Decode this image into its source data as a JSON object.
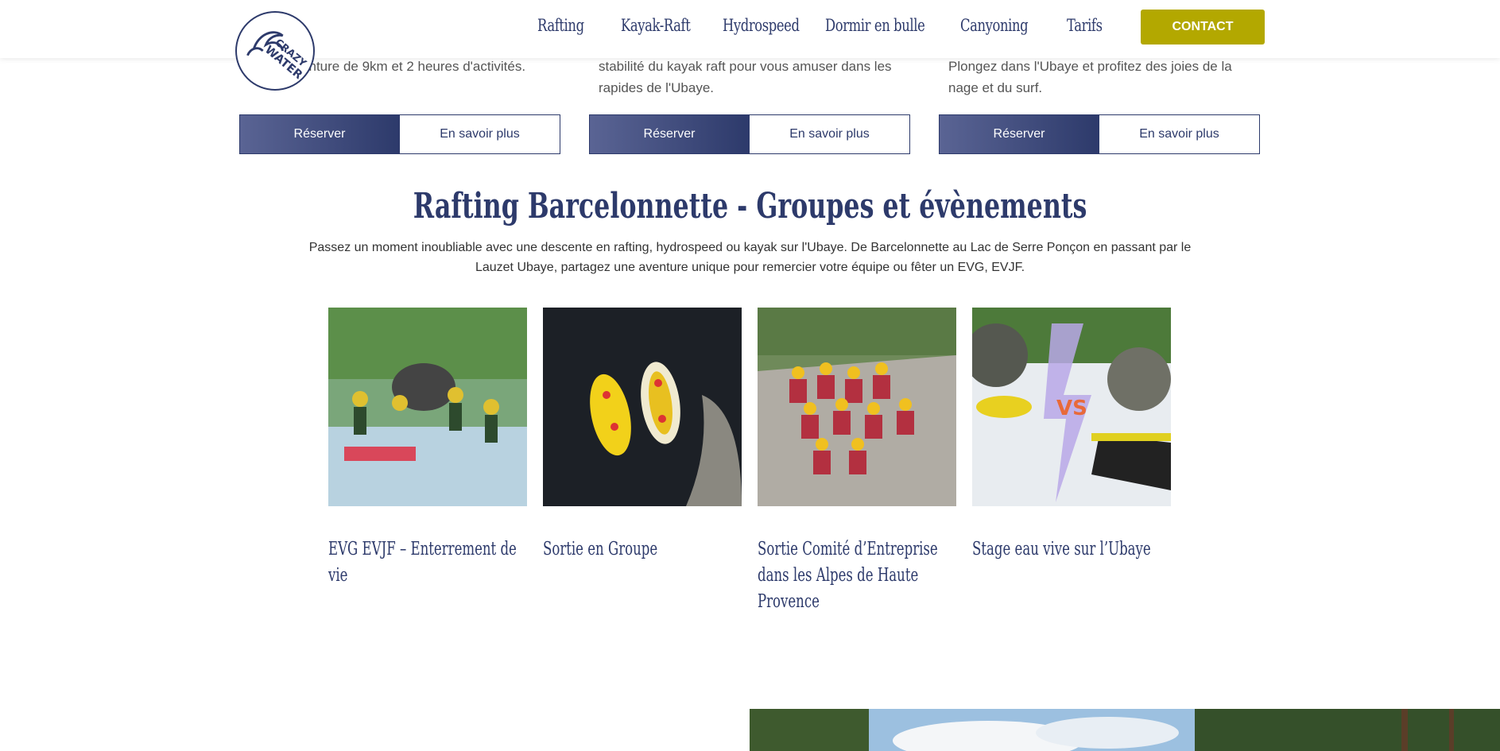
{
  "header": {
    "logo_alt": "Crazy Water",
    "nav": [
      {
        "label": "Rafting"
      },
      {
        "label": "Kayak-Raft"
      },
      {
        "label": "Hydrospeed"
      },
      {
        "label": "Dormir en bulle"
      },
      {
        "label": "Canyoning"
      },
      {
        "label": "Tarifs"
      }
    ],
    "contact_label": "CONTACT"
  },
  "cards": [
    {
      "text": "une aventure de 9km et 2 heures d'activités.",
      "reserve_label": "Réserver",
      "more_label": "En savoir plus"
    },
    {
      "text": "stabilité du kayak raft pour vous amuser dans les rapides de l'Ubaye.",
      "reserve_label": "Réserver",
      "more_label": "En savoir plus"
    },
    {
      "text": "Plongez dans l'Ubaye et profitez des joies de la nage et du surf.",
      "reserve_label": "Réserver",
      "more_label": "En savoir plus"
    }
  ],
  "section": {
    "title": "Rafting Barcelonnette - Groupes et évènements",
    "description": "Passez un moment inoubliable avec une descente en rafting, hydrospeed ou kayak sur l'Ubaye. De Barcelonnette au Lac de Serre Ponçon en passant par le Lauzet Ubaye, partagez une aventure unique pour remercier votre équipe ou fêter un EVG, EVJF."
  },
  "tiles": [
    {
      "title": "EVG EVJF – Enterrement de vie"
    },
    {
      "title": "Sortie en Groupe"
    },
    {
      "title": "Sortie Comité d’Entreprise dans les Alpes de Haute Provence"
    },
    {
      "title": "Stage eau vive sur l’Ubaye"
    }
  ],
  "colors": {
    "brand": "#2d3a6b",
    "accent": "#b3a800"
  }
}
